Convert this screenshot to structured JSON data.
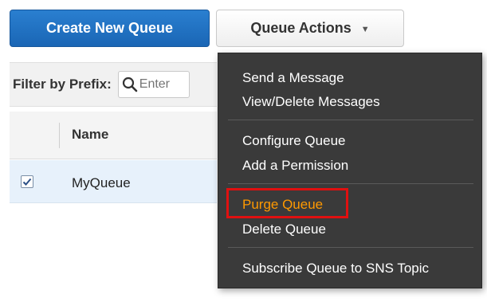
{
  "buttons": {
    "create_new_queue": "Create New Queue",
    "queue_actions": "Queue Actions"
  },
  "filter": {
    "label": "Filter by Prefix:",
    "placeholder": "Enter"
  },
  "table": {
    "columns": [
      "Name"
    ],
    "rows": [
      {
        "name": "MyQueue",
        "checked": true
      }
    ]
  },
  "menu": {
    "groups": [
      [
        "Send a Message",
        "View/Delete Messages"
      ],
      [
        "Configure Queue",
        "Add a Permission"
      ],
      [
        "Purge Queue",
        "Delete Queue"
      ],
      [
        "Subscribe Queue to SNS Topic"
      ]
    ],
    "highlighted_item": "Purge Queue"
  },
  "colors": {
    "primary_button": "#1a66b5",
    "menu_background": "#3a3a3a",
    "highlight_text": "#ff9900",
    "highlight_border": "#e01010",
    "selected_row": "#e7f1fb"
  }
}
